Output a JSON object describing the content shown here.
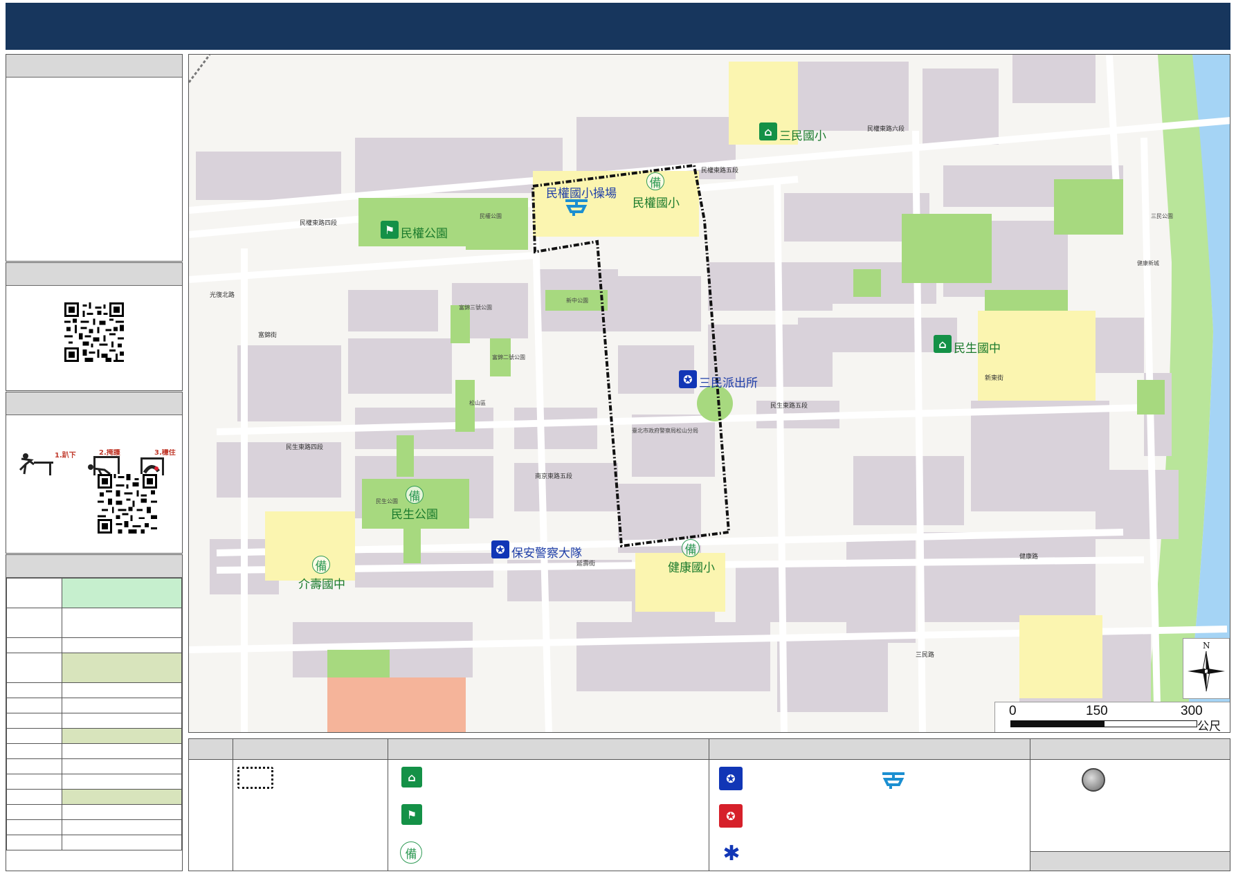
{
  "map": {
    "labels_big": [
      {
        "id": "sanmin-es",
        "text": "三民國小",
        "color": "green"
      },
      {
        "id": "minquan-es-field",
        "text": "民權國小操場",
        "color": "blue"
      },
      {
        "id": "minquan-es",
        "text": "民權國小",
        "color": "green"
      },
      {
        "id": "minquan-park",
        "text": "民權公園",
        "color": "green"
      },
      {
        "id": "minsheng-jhs",
        "text": "民生國中",
        "color": "green"
      },
      {
        "id": "sanmin-police",
        "text": "三民派出所",
        "color": "blue"
      },
      {
        "id": "minsheng-park",
        "text": "民生公園",
        "color": "green"
      },
      {
        "id": "baoan-police",
        "text": "保安警察大隊",
        "color": "blue"
      },
      {
        "id": "jieshou-jhs",
        "text": "介壽國中",
        "color": "green"
      },
      {
        "id": "jiankang-es",
        "text": "健康國小",
        "color": "green"
      }
    ],
    "labels_small": [
      "民權東路四段",
      "民權東路五段",
      "民權東路六段",
      "民生東路五段",
      "民生東路四段",
      "光復北路",
      "延壽街",
      "健康路",
      "新東街",
      "三民路",
      "富錦街",
      "南京東路五段",
      "松山區",
      "臺北市政府警察局松山分局",
      "民生公園",
      "新中公園",
      "三民公園",
      "健康新城",
      "民權公園",
      "富錦三號公園",
      "富錦二號公園"
    ],
    "scale": {
      "ticks": [
        "0",
        "150",
        "300"
      ],
      "unit": "公尺"
    },
    "north_label": "N"
  },
  "legend": {
    "symbol_names": [
      "boundary-line-icon",
      "shelter-school-icon",
      "park-evacuation-icon",
      "standby-icon",
      "police-icon",
      "helipad-icon",
      "fire-station-icon",
      "medical-icon",
      "water-point-icon"
    ]
  },
  "colors": {
    "header": "#17365d",
    "park": "#a7d97f",
    "school": "#fbf5b0",
    "river": "#a5d4f5",
    "building": "#d9d2da",
    "road": "#ffffff"
  }
}
